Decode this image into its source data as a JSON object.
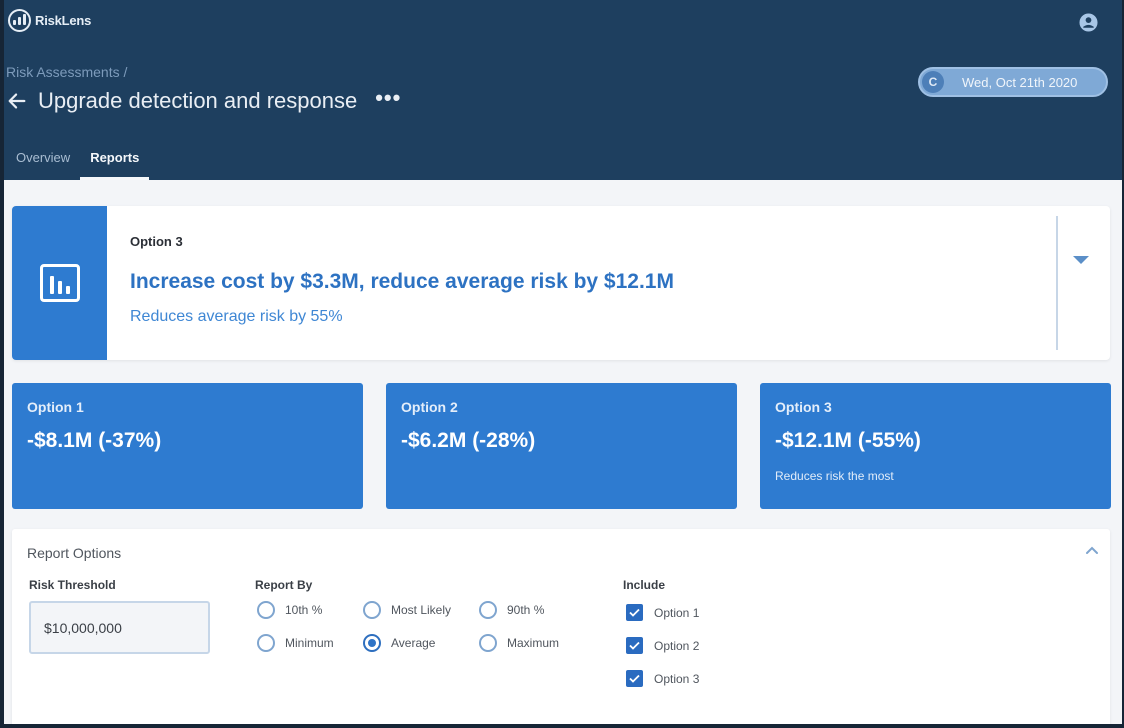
{
  "app": {
    "name": "RiskLens"
  },
  "header": {
    "breadcrumb": "Risk Assessments /",
    "title": "Upgrade detection and response",
    "more_label": "•••",
    "date_avatar_initial": "C",
    "date": "Wed, Oct 21th 2020"
  },
  "tabs": [
    {
      "label": "Overview",
      "active": false
    },
    {
      "label": "Reports",
      "active": true
    }
  ],
  "summary": {
    "option_label": "Option 3",
    "headline": "Increase cost by $3.3M, reduce average risk by $12.1M",
    "subline": "Reduces average risk by 55%"
  },
  "options": [
    {
      "label": "Option 1",
      "value": "-$8.1M (-37%)",
      "note": ""
    },
    {
      "label": "Option 2",
      "value": "-$6.2M (-28%)",
      "note": ""
    },
    {
      "label": "Option 3",
      "value": "-$12.1M (-55%)",
      "note": "Reduces risk the most"
    }
  ],
  "report_options": {
    "title": "Report Options",
    "risk_threshold": {
      "label": "Risk Threshold",
      "value": "$10,000,000"
    },
    "report_by": {
      "label": "Report By",
      "options": [
        {
          "label": "10th %",
          "checked": false
        },
        {
          "label": "Most Likely",
          "checked": false
        },
        {
          "label": "90th %",
          "checked": false
        },
        {
          "label": "Minimum",
          "checked": false
        },
        {
          "label": "Average",
          "checked": true
        },
        {
          "label": "Maximum",
          "checked": false
        }
      ]
    },
    "include": {
      "label": "Include",
      "options": [
        {
          "label": "Option 1",
          "checked": true
        },
        {
          "label": "Option 2",
          "checked": true
        },
        {
          "label": "Option 3",
          "checked": true
        }
      ]
    }
  },
  "colors": {
    "header_bg": "#1e3f5f",
    "accent_blue": "#2e7bd0",
    "page_bg": "#f3f5f8"
  }
}
